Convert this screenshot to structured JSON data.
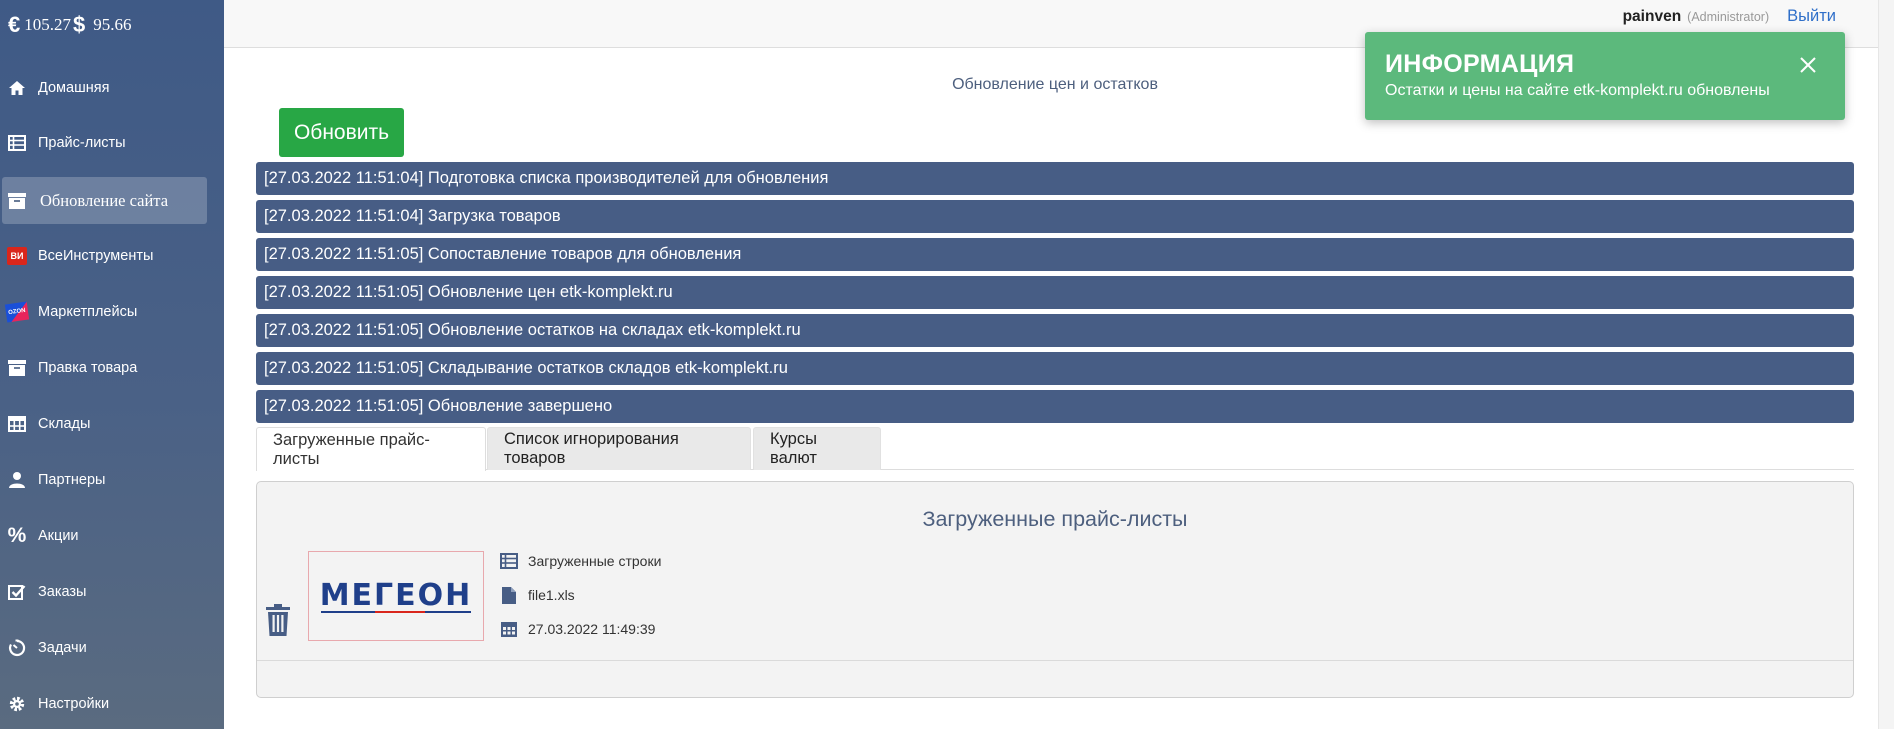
{
  "currency": {
    "eur_value": "105.27",
    "usd_value": "95.66"
  },
  "sidebar": {
    "items": [
      {
        "label": "Домашняя",
        "icon": "home-icon"
      },
      {
        "label": "Прайс-листы",
        "icon": "list-icon"
      },
      {
        "label": "Обновление сайта",
        "icon": "box-icon",
        "active": true
      },
      {
        "label": "ВсеИнструменты",
        "icon": "vseinstrumenty-logo-icon"
      },
      {
        "label": "Маркетплейсы",
        "icon": "ozon-logo-icon"
      },
      {
        "label": "Правка товара",
        "icon": "box-icon"
      },
      {
        "label": "Склады",
        "icon": "table-icon"
      },
      {
        "label": "Партнеры",
        "icon": "user-icon"
      },
      {
        "label": "Акции",
        "icon": "percent-icon"
      },
      {
        "label": "Заказы",
        "icon": "checkbox-icon"
      },
      {
        "label": "Задачи",
        "icon": "timer-icon"
      },
      {
        "label": "Настройки",
        "icon": "gear-icon"
      }
    ]
  },
  "header": {
    "username": "painven",
    "role": "(Administrator)",
    "logout_label": "Выйти"
  },
  "main": {
    "heading": "Обновление цен и остатков",
    "refresh_label": "Обновить",
    "log": [
      "[27.03.2022 11:51:04] Подготовка списка производителей для обновления",
      "[27.03.2022 11:51:04] Загрузка товаров",
      "[27.03.2022 11:51:05] Сопоставление товаров для обновления",
      "[27.03.2022 11:51:05] Обновление цен etk-komplekt.ru",
      "[27.03.2022 11:51:05] Обновление остатков на складах etk-komplekt.ru",
      "[27.03.2022 11:51:05] Складывание остатков складов etk-komplekt.ru",
      "[27.03.2022 11:51:05] Обновление завершено"
    ],
    "tabs": [
      {
        "label": "Загруженные прайс-листы",
        "active": true
      },
      {
        "label": "Список игнорирования товаров"
      },
      {
        "label": "Курсы валют"
      }
    ],
    "panel": {
      "title": "Загруженные прайс-листы",
      "logo_text": "МЕГЕОН",
      "rows_label": "Загруженные строки",
      "file_name": "file1.xls",
      "date": "27.03.2022 11:49:39"
    }
  },
  "toast": {
    "title": "ИНФОРМАЦИЯ",
    "message": "Остатки и цены на сайте etk-komplekt.ru обновлены"
  },
  "colors": {
    "sidebar_bg": "#475d85",
    "log_row_bg": "#475d85",
    "refresh_button": "#28a745",
    "toast_bg": "#5cb97c",
    "link": "#2f6fc9"
  }
}
